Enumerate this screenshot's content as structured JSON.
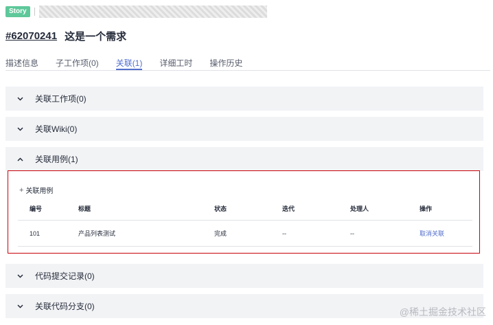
{
  "header": {
    "tag": "Story",
    "id": "#62070241",
    "title": "这是一个需求"
  },
  "tabs": [
    {
      "label": "描述信息",
      "active": false
    },
    {
      "label": "子工作项(0)",
      "active": false
    },
    {
      "label": "关联(1)",
      "active": true
    },
    {
      "label": "详细工时",
      "active": false
    },
    {
      "label": "操作历史",
      "active": false
    }
  ],
  "sections": [
    {
      "label": "关联工作项(0)",
      "expanded": false
    },
    {
      "label": "关联Wiki(0)",
      "expanded": false
    },
    {
      "label": "关联用例(1)",
      "expanded": true
    },
    {
      "label": "代码提交记录(0)",
      "expanded": false
    },
    {
      "label": "关联代码分支(0)",
      "expanded": false
    }
  ],
  "testcase_panel": {
    "add_label": "关联用例",
    "columns": [
      "编号",
      "标题",
      "状态",
      "迭代",
      "处理人",
      "操作"
    ],
    "rows": [
      {
        "id": "101",
        "title": "产品列表测试",
        "status": "完成",
        "iteration": "--",
        "assignee": "--",
        "action": "取消关联"
      }
    ]
  },
  "watermark": "@稀土掘金技术社区",
  "colors": {
    "accent": "#526ecc",
    "tag": "#5ec89a",
    "highlight_border": "#c7000b",
    "section_bg": "#f2f3f5"
  }
}
